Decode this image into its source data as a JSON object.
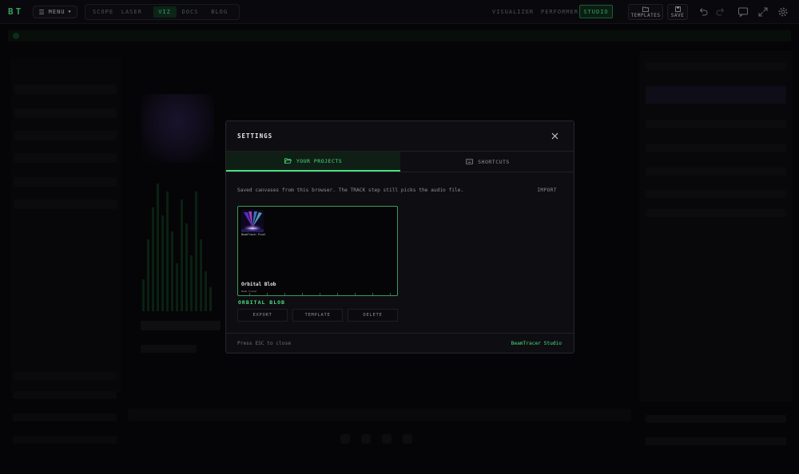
{
  "app": {
    "logo": "BT",
    "menu_label": "MENU",
    "nav_tabs": [
      "SCOPE",
      "LASER",
      "VIZ",
      "DOCS",
      "BLOG"
    ],
    "active_nav": "VIZ",
    "modes": [
      "VISUALIZER",
      "PERFORMER",
      "STUDIO"
    ],
    "active_mode": "STUDIO",
    "toolbar": {
      "templates_label": "TEMPLATES",
      "save_label": "SAVE"
    },
    "colors": {
      "accent": "#4ade80",
      "background": "#08080a",
      "panel": "#0e0e12"
    }
  },
  "modal": {
    "title": "SETTINGS",
    "tabs": [
      {
        "label": "YOUR PROJECTS",
        "icon": "folder-open-icon",
        "active": true
      },
      {
        "label": "SHORTCUTS",
        "icon": "keyboard-icon",
        "active": false
      }
    ],
    "description": "Saved canvases from this browser. The TRACK step still picks the audio file.",
    "import_label": "IMPORT",
    "project": {
      "thumb_caption": "BeamTracer Pixel",
      "card_title": "Orbital Blob",
      "card_subtitle": "Beam Tracer",
      "name": "ORBITAL BLOB",
      "actions": [
        "EXPORT",
        "TEMPLATE",
        "DELETE"
      ]
    },
    "footer_hint": "Press ESC to close",
    "footer_brand": "BeamTracer Studio"
  }
}
